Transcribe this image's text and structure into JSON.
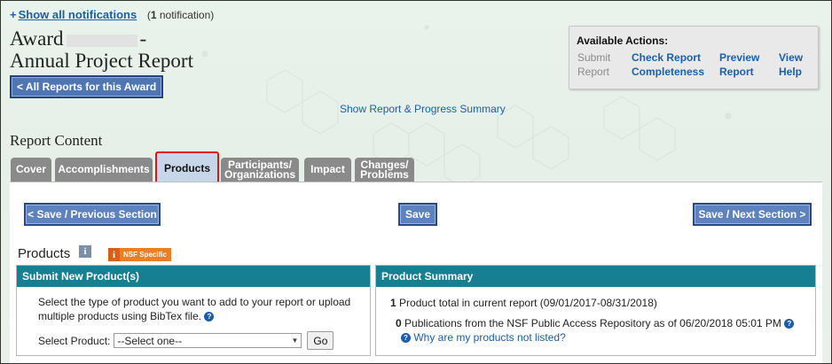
{
  "notifications": {
    "link_label": "Show all notifications",
    "count_number": "1",
    "count_suffix": "notification"
  },
  "header": {
    "award_prefix": "Award",
    "award_suffix": "-",
    "report_title": "Annual Project Report",
    "all_reports_button": "< All Reports for this Award"
  },
  "available_actions": {
    "title": "Available Actions:",
    "items": [
      {
        "line1": "Submit",
        "line2": "Report",
        "enabled": false
      },
      {
        "line1": "Check Report",
        "line2": "Completeness",
        "enabled": true
      },
      {
        "line1": "Preview",
        "line2": "Report",
        "enabled": true
      },
      {
        "line1": "View",
        "line2": "Help",
        "enabled": true
      }
    ]
  },
  "summary_link": "Show Report & Progress Summary",
  "report_content_title": "Report Content",
  "tabs": [
    {
      "line1": "Cover",
      "line2": ""
    },
    {
      "line1": "Accomplishments",
      "line2": ""
    },
    {
      "line1": "Products",
      "line2": "",
      "active": true
    },
    {
      "line1": "Participants/",
      "line2": "Organizations"
    },
    {
      "line1": "Impact",
      "line2": ""
    },
    {
      "line1": "Changes/",
      "line2": "Problems"
    }
  ],
  "nav_buttons": {
    "prev": "< Save / Previous Section",
    "save": "Save",
    "next": "Save / Next Section >"
  },
  "products_section": {
    "label": "Products",
    "nsf_badge": "NSF Specific"
  },
  "submit_box": {
    "header": "Submit New Product(s)",
    "instructions": "Select the type of product you want to add to your report or upload multiple products using BibTex file.",
    "select_label": "Select Product:",
    "select_value": "--Select one--",
    "go_label": "Go"
  },
  "summary_box": {
    "header": "Product Summary",
    "total_count": "1",
    "total_text": "Product total in current report (09/01/2017-08/31/2018)",
    "pub_count": "0",
    "pub_text": "Publications from the NSF Public Access Repository as of 06/20/2018 05:01 PM",
    "why_link": "Why are my products not listed?"
  },
  "colors": {
    "link": "#1a5fa8",
    "section_header": "#177f92",
    "tab_inactive": "#8a8a8a",
    "tab_active_border": "#e0131b",
    "button_blue": "#4f76b0",
    "nsf_badge": "#ef7d22"
  }
}
